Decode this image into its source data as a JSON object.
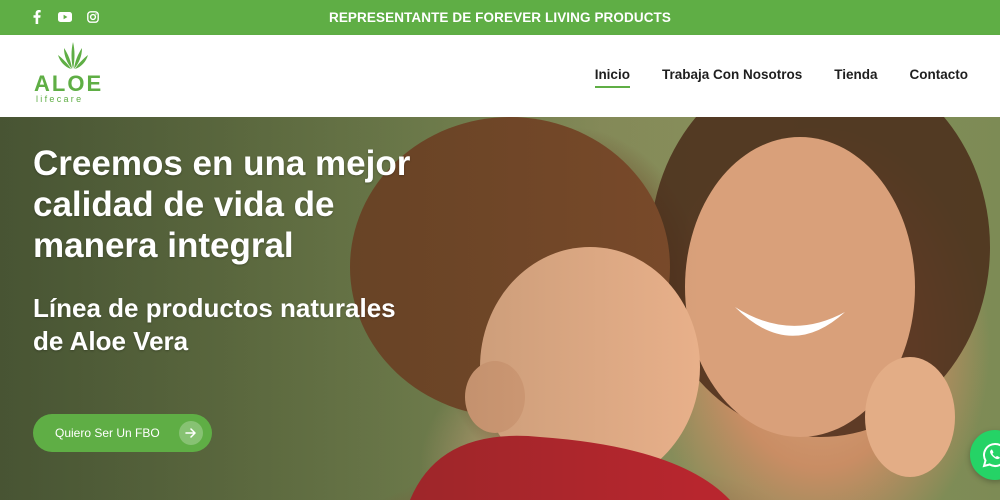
{
  "topbar": {
    "tagline": "REPRESENTANTE DE FOREVER LIVING PRODUCTS",
    "socials": [
      "facebook-icon",
      "youtube-icon",
      "instagram-icon"
    ],
    "background": "#5fae45"
  },
  "logo": {
    "word": "ALOE",
    "sub": "lifecare",
    "color": "#5fae45"
  },
  "nav": {
    "items": [
      {
        "label": "Inicio",
        "active": true
      },
      {
        "label": "Trabaja Con Nosotros",
        "active": false
      },
      {
        "label": "Tienda",
        "active": false
      },
      {
        "label": "Contacto",
        "active": false
      }
    ]
  },
  "hero": {
    "headline": "Creemos en una mejor calidad de vida de manera integral",
    "subline": "Línea de productos naturales de Aloe Vera",
    "cta_label": "Quiero Ser Un FBO",
    "cta_icon": "arrow-right-icon"
  },
  "floating": {
    "whatsapp_icon": "whatsapp-icon",
    "color": "#25d366"
  }
}
